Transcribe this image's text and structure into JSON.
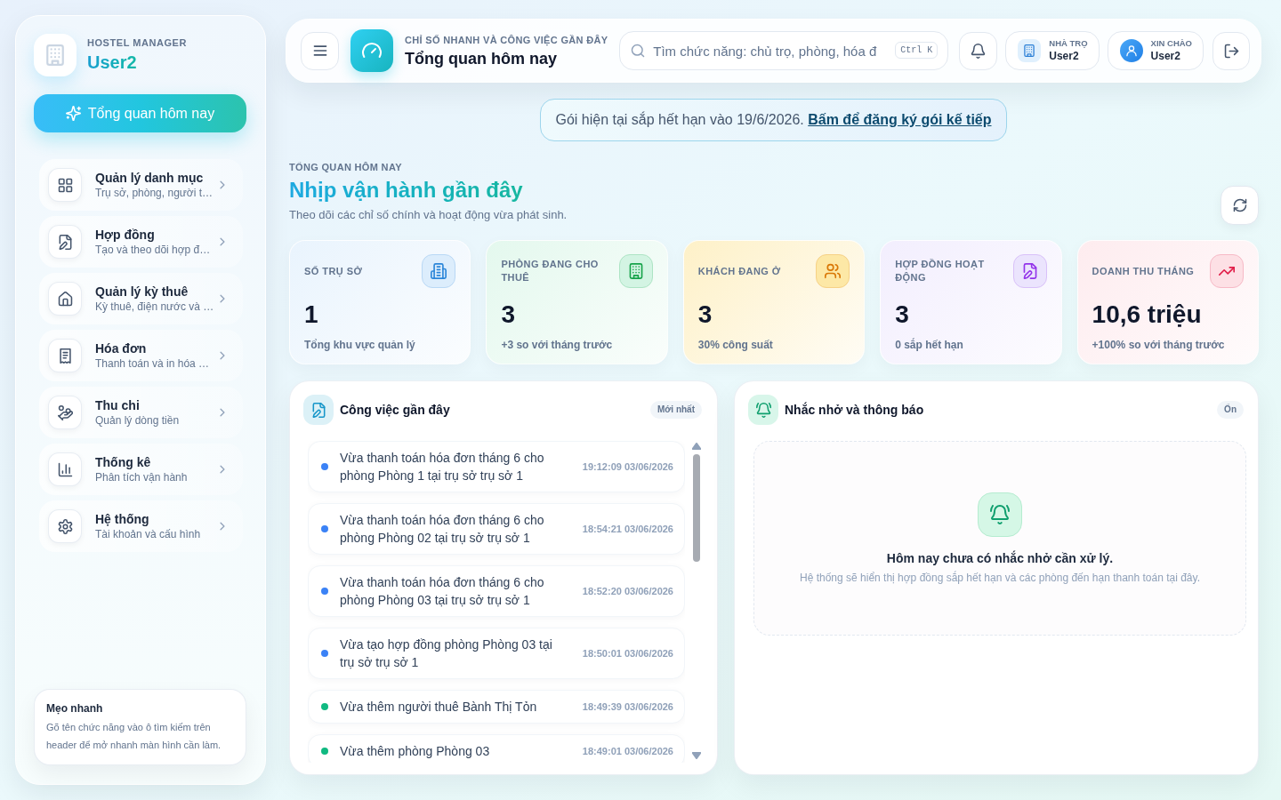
{
  "sidebar": {
    "brand_caption": "HOSTEL MANAGER",
    "account_name": "User2",
    "primary_button": "Tổng quan hôm nay",
    "nav_items": [
      {
        "title": "Quản lý danh mục",
        "subtitle": "Trụ sở, phòng, người t…"
      },
      {
        "title": "Hợp đồng",
        "subtitle": "Tạo và theo dõi hợp đ…"
      },
      {
        "title": "Quản lý kỳ thuê",
        "subtitle": "Kỳ thuê, điện nước và …"
      },
      {
        "title": "Hóa đơn",
        "subtitle": "Thanh toán và in hóa …"
      },
      {
        "title": "Thu chi",
        "subtitle": "Quản lý dòng tiền"
      },
      {
        "title": "Thống kê",
        "subtitle": "Phân tích vận hành"
      },
      {
        "title": "Hệ thống",
        "subtitle": "Tài khoản và cấu hình"
      }
    ],
    "tip": {
      "title": "Mẹo nhanh",
      "text": "Gõ tên chức năng vào ô tìm kiếm trên header để mở nhanh màn hình cần làm."
    }
  },
  "header": {
    "caption": "CHỈ SỐ NHANH VÀ CÔNG VIỆC GẦN ĐÂY",
    "title": "Tổng quan hôm nay",
    "search": {
      "placeholder": "Tìm chức năng: chủ trọ, phòng, hóa đ",
      "shortcut": "Ctrl K"
    },
    "hostel": {
      "caption": "NHÀ TRỌ",
      "value": "User2"
    },
    "greeting": {
      "caption": "XIN CHÀO",
      "value": "User2"
    }
  },
  "banner": {
    "text": "Gói hiện tại sắp hết hạn vào 19/6/2026.",
    "link": "Bấm để đăng ký gói kế tiếp"
  },
  "overview": {
    "eyebrow": "TỔNG QUAN HÔM NAY",
    "title": "Nhịp vận hành gần đây",
    "subtitle": "Theo dõi các chỉ số chính và hoạt động vừa phát sinh."
  },
  "stats": [
    {
      "label": "SỐ TRỤ SỞ",
      "value": "1",
      "note": "Tổng khu vực quản lý",
      "color": "#dcedfc"
    },
    {
      "label": "PHÒNG ĐANG CHO THUÊ",
      "value": "3",
      "note": "+3 so với tháng trước",
      "color": "#d3f4e3"
    },
    {
      "label": "KHÁCH ĐANG Ở",
      "value": "3",
      "note": "30% công suất",
      "color": "#fde8a6"
    },
    {
      "label": "HỢP ĐỒNG HOẠT ĐỘNG",
      "value": "3",
      "note": "0 sắp hết hạn",
      "color": "#ebe4fd"
    },
    {
      "label": "DOANH THU THÁNG",
      "value": "10,6 triệu",
      "note": "+100% so với tháng trước",
      "color": "#fde0e5"
    }
  ],
  "recent": {
    "title": "Công việc gần đây",
    "badge": "Mới nhất",
    "items": [
      {
        "text": "Vừa thanh toán hóa đơn tháng 6 cho phòng Phòng 1 tại trụ sở trụ sở 1",
        "time": "19:12:09 03/06/2026",
        "color": "#3b82f6"
      },
      {
        "text": "Vừa thanh toán hóa đơn tháng 6 cho phòng Phòng 02 tại trụ sở trụ sở 1",
        "time": "18:54:21 03/06/2026",
        "color": "#3b82f6"
      },
      {
        "text": "Vừa thanh toán hóa đơn tháng 6 cho phòng Phòng 03 tại trụ sở trụ sở 1",
        "time": "18:52:20 03/06/2026",
        "color": "#3b82f6"
      },
      {
        "text": "Vừa tạo hợp đồng phòng Phòng 03 tại trụ sở trụ sở 1",
        "time": "18:50:01 03/06/2026",
        "color": "#3b82f6"
      },
      {
        "text": "Vừa thêm người thuê Bành Thị Tỏn",
        "time": "18:49:39 03/06/2026",
        "color": "#10b981"
      },
      {
        "text": "Vừa thêm phòng Phòng 03",
        "time": "18:49:01 03/06/2026",
        "color": "#10b981"
      }
    ]
  },
  "reminders": {
    "title": "Nhắc nhở và thông báo",
    "badge": "Ổn",
    "empty_title": "Hôm nay chưa có nhắc nhở cần xử lý.",
    "empty_text": "Hệ thống sẽ hiển thị hợp đồng sắp hết hạn và các phòng đến hạn thanh toán tại đây."
  }
}
